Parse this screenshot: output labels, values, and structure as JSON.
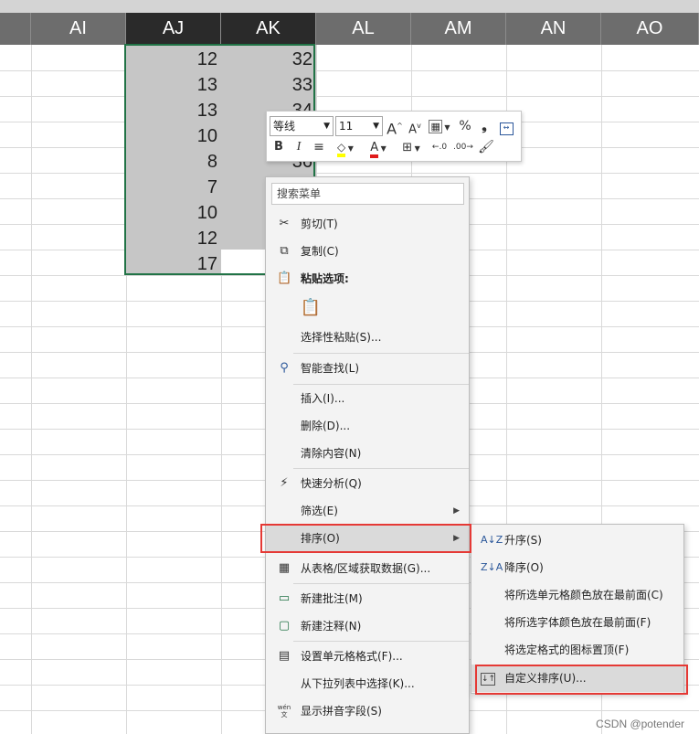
{
  "columns": [
    {
      "name": "AI",
      "selected": false
    },
    {
      "name": "AJ",
      "selected": true
    },
    {
      "name": "AK",
      "selected": true
    },
    {
      "name": "AL",
      "selected": false
    },
    {
      "name": "AM",
      "selected": false
    },
    {
      "name": "AN",
      "selected": false
    },
    {
      "name": "AO",
      "selected": false
    }
  ],
  "cells": {
    "aj": [
      "12",
      "13",
      "13",
      "10",
      "8",
      "7",
      "10",
      "12",
      "17"
    ],
    "ak": [
      "32",
      "33",
      "34",
      "",
      "36"
    ]
  },
  "mini_toolbar": {
    "font_name": "等线",
    "font_size": "11",
    "grow_font": "A",
    "shrink_font": "A",
    "percent": "%",
    "comma": "❟",
    "bold": "B",
    "italic": "I",
    "font_color_letter": "A",
    "highlight_color": "#ffff00",
    "font_color": "#e01b1b"
  },
  "context_menu": {
    "search_placeholder": "搜索菜单",
    "items": {
      "cut": "剪切(T)",
      "copy": "复制(C)",
      "paste_options": "粘贴选项:",
      "paste_special": "选择性粘贴(S)...",
      "smart_lookup": "智能查找(L)",
      "insert": "插入(I)...",
      "delete": "删除(D)...",
      "clear_contents": "清除内容(N)",
      "quick_analysis": "快速分析(Q)",
      "filter": "筛选(E)",
      "sort": "排序(O)",
      "get_data": "从表格/区域获取数据(G)...",
      "new_comment": "新建批注(M)",
      "new_note": "新建注释(N)",
      "format_cells": "设置单元格格式(F)...",
      "pick_from_list": "从下拉列表中选择(K)...",
      "phonetic": "显示拼音字段(S)",
      "phonetic_icon": "wén 文"
    }
  },
  "sort_submenu": {
    "ascending": "升序(S)",
    "descending": "降序(O)",
    "cell_color_top": "将所选单元格颜色放在最前面(C)",
    "font_color_top": "将所选字体颜色放在最前面(F)",
    "icon_top": "将选定格式的图标置顶(F)",
    "custom_sort": "自定义排序(U)..."
  },
  "watermark": "CSDN @potender",
  "colors": {
    "selection_border": "#217346",
    "highlight_red": "#e53935",
    "header_bg": "#6d6d6d",
    "header_selected_bg": "#2a2a2a"
  }
}
